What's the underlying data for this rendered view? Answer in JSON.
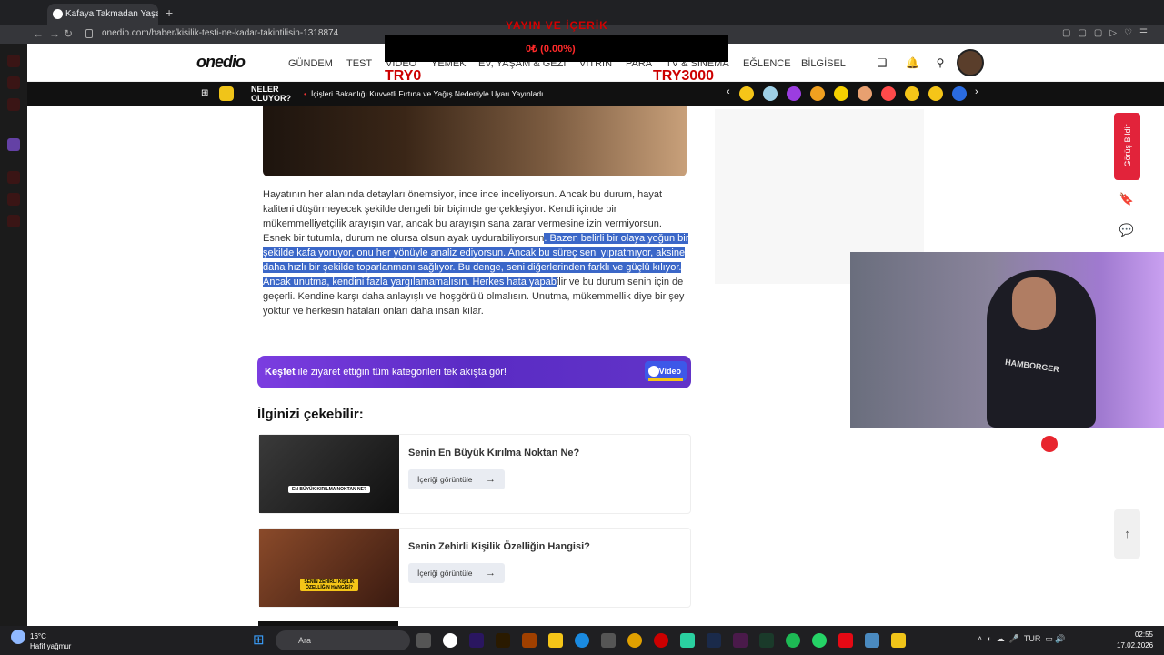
{
  "browser": {
    "tab_title": "Kafaya Takmadan Yaşayab",
    "url": "onedio.com/haber/kisilik-testi-ne-kadar-takintilisin-1318874"
  },
  "stream_overlay": {
    "title": "YAYIN VE İÇERİK",
    "amount": "0₺ (0.00%)",
    "goal_start": "TRY0",
    "goal_end": "TRY3000"
  },
  "site": {
    "logo": "onedio",
    "nav": [
      "GÜNDEM",
      "TEST",
      "VİDEO",
      "YEMEK",
      "EV, YAŞAM & GEZİ",
      "VİTRİN",
      "PARA",
      "TV & SİNEMA",
      "EĞLENCE",
      "BİLGİSEL"
    ]
  },
  "news_bar": {
    "label": "NELER OLUYOR?",
    "headline": "İçişleri Bakanlığı Kuvvetli Fırtına ve Yağış Nedeniyle Uyarı Yayınladı"
  },
  "article": {
    "para_plain1": "Hayatının her alanında detayları önemsiyor, ince ince inceliyorsun. Ancak bu durum, hayat kaliteni düşürmeyecek şekilde dengeli bir biçimde gerçekleşiyor. Kendi içinde bir mükemmelliyetçilik arayışın var, ancak bu arayışın sana zarar vermesine izin vermiyorsun. Esnek bir tutumla, durum ne olursa olsun ayak uydurabiliyorsun",
    "para_highlight": ". Bazen belirli bir olaya yoğun bir şekilde kafa yoruyor, onu her yönüyle analiz ediyorsun. Ancak bu süreç seni yıpratmıyor, aksine daha hızlı bir şekilde toparlanmanı sağlıyor. Bu denge, seni diğerlerinden farklı ve güçlü kılıyor. Ancak unutma, kendini fazla yargılamamalısın. Herkes hata yapab",
    "para_plain2": "ilir ve bu durum senin için de geçerli. Kendine karşı daha anlayışlı ve hoşgörülü olmalısın. Unutma, mükemmellik diye bir şey yoktur ve herkesin hataları onları daha insan kılar."
  },
  "kesfet": {
    "bold": "Keşfet",
    "text": " ile ziyaret ettiğin tüm kategorileri tek akışta gör!",
    "badge": "Video"
  },
  "related": {
    "heading": "İlginizi çekebilir:",
    "items": [
      {
        "title": "Senin En Büyük Kırılma Noktan Ne?",
        "thumb_label": "EN BÜYÜK KIRILMA NOKTAN NE?",
        "button": "İçeriği görüntüle"
      },
      {
        "title": "Senin Zehirli Kişilik Özelliğin Hangisi?",
        "thumb_label": "SENİN ZEHİRLİ KİŞİLİK ÖZELLİĞİN HANGİSİ?",
        "button": "İçeriği görüntüle"
      }
    ]
  },
  "sidebar": {
    "feedback": "Görüş Bildir"
  },
  "webcam": {
    "hoodie_text": "HAMBORGER"
  },
  "taskbar": {
    "temp": "16°C",
    "weather": "Hafif yağmur",
    "search": "Ara",
    "lang": "TUR",
    "time": "02:55",
    "date": "17.02.2026"
  },
  "colors": {
    "accent_red": "#e2233a",
    "highlight": "#3b67c8",
    "kesfet_purple": "#6a35d4"
  }
}
